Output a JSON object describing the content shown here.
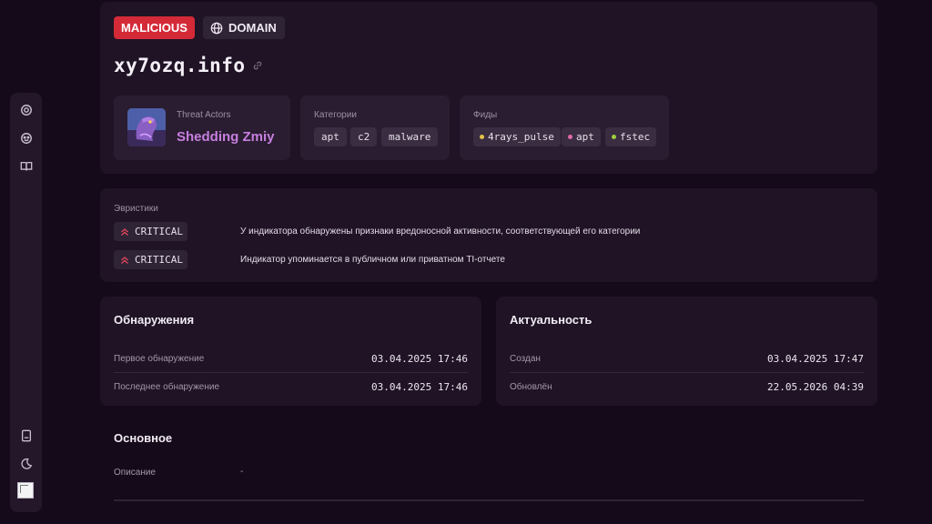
{
  "indicator": {
    "verdict": "MALICIOUS",
    "type_label": "DOMAIN",
    "name": "xy7ozq.info"
  },
  "threat_actors": {
    "label": "Threat Actors",
    "name": "Shedding Zmiy"
  },
  "categories": {
    "label": "Категории",
    "items": [
      "apt",
      "c2",
      "malware"
    ]
  },
  "feeds": {
    "label": "Фиды",
    "items": [
      {
        "name": "4rays_pulse",
        "color": "#e6c14a"
      },
      {
        "name": "apt",
        "color": "#e06aa8"
      },
      {
        "name": "fstec",
        "color": "#9ccf3a"
      }
    ]
  },
  "heuristics": {
    "label": "Эвристики",
    "items": [
      {
        "severity": "CRITICAL",
        "text": "У индикатора обнаружены признаки вредоносной активности, соответствующей его категории"
      },
      {
        "severity": "CRITICAL",
        "text": "Индикатор упоминается в публичном или приватном TI-отчете"
      }
    ]
  },
  "detections": {
    "title": "Обнаружения",
    "rows": [
      {
        "label": "Первое обнаружение",
        "value": "03.04.2025 17:46"
      },
      {
        "label": "Последнее обнаружение",
        "value": "03.04.2025 17:46"
      }
    ]
  },
  "relevance": {
    "title": "Актуальность",
    "rows": [
      {
        "label": "Создан",
        "value": "03.04.2025 17:47"
      },
      {
        "label": "Обновлён",
        "value": "22.05.2026 04:39"
      }
    ]
  },
  "basic": {
    "title": "Основное",
    "rows": [
      {
        "label": "Описание",
        "value": "-"
      }
    ]
  },
  "colors": {
    "malicious": "#d42a38",
    "actor_accent": "#c77fe0",
    "critical_icon": "#e0455a"
  },
  "sidebar_icons": [
    "target-icon",
    "face-icon",
    "book-icon",
    "document-icon",
    "moon-icon"
  ]
}
